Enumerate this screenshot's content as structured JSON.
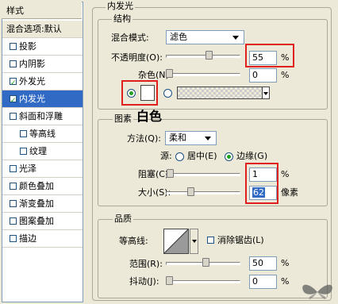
{
  "sidebar": {
    "header": "样式",
    "blend_options": "混合选项:默认",
    "items": [
      {
        "label": "投影",
        "checked": false,
        "selected": false,
        "sub": false
      },
      {
        "label": "内阴影",
        "checked": false,
        "selected": false,
        "sub": false
      },
      {
        "label": "外发光",
        "checked": true,
        "selected": false,
        "sub": false
      },
      {
        "label": "内发光",
        "checked": true,
        "selected": true,
        "sub": false
      },
      {
        "label": "斜面和浮雕",
        "checked": false,
        "selected": false,
        "sub": false
      },
      {
        "label": "等高线",
        "checked": false,
        "selected": false,
        "sub": true
      },
      {
        "label": "纹理",
        "checked": false,
        "selected": false,
        "sub": true
      },
      {
        "label": "光泽",
        "checked": false,
        "selected": false,
        "sub": false
      },
      {
        "label": "颜色叠加",
        "checked": false,
        "selected": false,
        "sub": false
      },
      {
        "label": "渐变叠加",
        "checked": false,
        "selected": false,
        "sub": false
      },
      {
        "label": "图案叠加",
        "checked": false,
        "selected": false,
        "sub": false
      },
      {
        "label": "描边",
        "checked": false,
        "selected": false,
        "sub": false
      }
    ]
  },
  "panel": {
    "title": "内发光",
    "structure": {
      "title": "结构",
      "blend_mode_label": "混合模式:",
      "blend_mode_value": "滤色",
      "opacity_label": "不透明度(O):",
      "opacity_value": "55",
      "opacity_unit": "%",
      "noise_label": "杂色(N):",
      "noise_value": "0",
      "noise_unit": "%",
      "color_mode": "solid",
      "glow_color": "#ffffff"
    },
    "elements": {
      "title": "图素",
      "annotation": "白色",
      "technique_label": "方法(Q):",
      "technique_value": "柔和",
      "source_label": "源:",
      "source_center": "居中(E)",
      "source_edge": "边缘(G)",
      "source_selected": "edge",
      "choke_label": "阻塞(C):",
      "choke_value": "1",
      "choke_unit": "%",
      "size_label": "大小(S):",
      "size_value": "62",
      "size_unit": "像素"
    },
    "quality": {
      "title": "品质",
      "contour_label": "等高线:",
      "antialias_label": "消除锯齿(L)",
      "antialias_checked": false,
      "range_label": "范围(R):",
      "range_value": "50",
      "range_unit": "%",
      "jitter_label": "抖动(J):",
      "jitter_value": "0",
      "jitter_unit": "%"
    }
  },
  "colors": {
    "accent_red": "#e0201e",
    "selection": "#316ac5",
    "check": "#21a121"
  }
}
